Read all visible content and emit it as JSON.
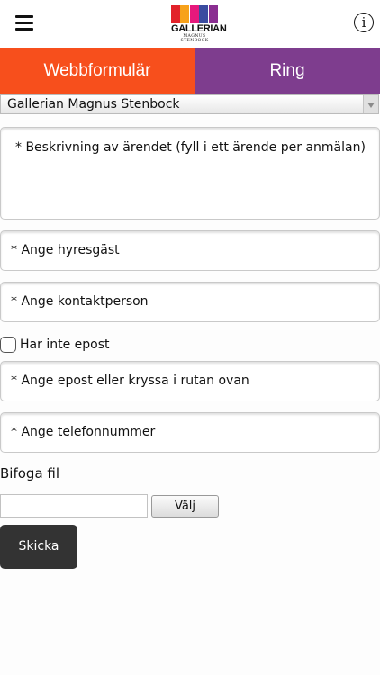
{
  "header": {
    "menu_icon": "hamburger-menu-icon",
    "info_icon": "info-icon",
    "info_glyph": "i",
    "logo": {
      "name": "GALLERIAN",
      "subtitle": "MAGNUS STENBOCK",
      "bar_colors": [
        "#e2222a",
        "#f7a21b",
        "#e6197c",
        "#3a4ca0",
        "#8a2e91"
      ]
    }
  },
  "tabs": [
    {
      "label": "Webbformulär",
      "color": "#f74f1c",
      "active": true
    },
    {
      "label": "Ring",
      "color": "#7e3d8e",
      "active": false
    }
  ],
  "form": {
    "location_select": {
      "value": "Gallerian Magnus Stenbock"
    },
    "description": {
      "placeholder": "* Beskrivning av ärendet (fyll i ett ärende per anmälan)"
    },
    "tenant": {
      "placeholder": "* Ange hyresgäst"
    },
    "contact_person": {
      "placeholder": "* Ange kontaktperson"
    },
    "no_email": {
      "label": "Har inte epost",
      "checked": false
    },
    "email": {
      "placeholder": "* Ange epost eller kryssa i rutan ovan"
    },
    "phone": {
      "placeholder": "* Ange telefonnummer"
    },
    "attachment": {
      "label": "Bifoga fil",
      "choose_button": "Välj",
      "file_value": ""
    },
    "submit_label": "Skicka"
  }
}
